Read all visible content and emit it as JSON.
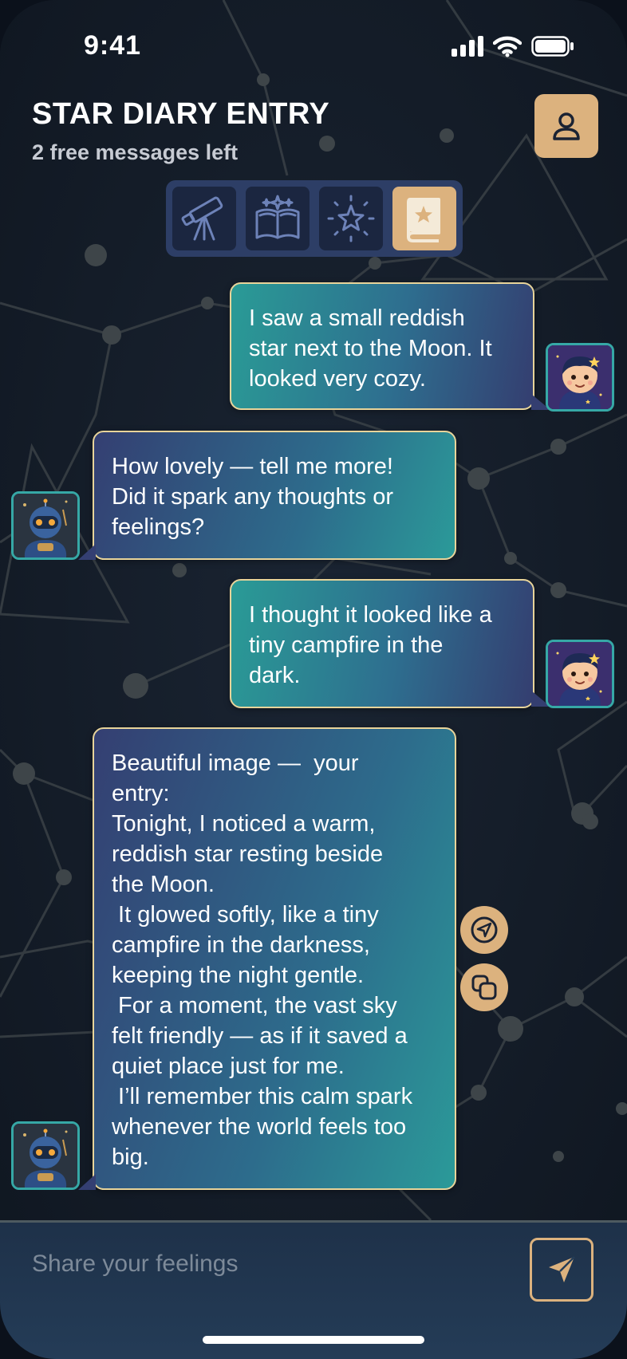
{
  "status": {
    "time": "9:41"
  },
  "header": {
    "title": "STAR DIARY ENTRY",
    "subtitle": "2 free messages left"
  },
  "modes": [
    {
      "icon": "telescope-icon",
      "active": false
    },
    {
      "icon": "open-book-sparkle-icon",
      "active": false
    },
    {
      "icon": "shining-star-icon",
      "active": false
    },
    {
      "icon": "star-diary-book-icon",
      "active": true
    }
  ],
  "messages": [
    {
      "role": "user",
      "lines": [
        "I saw a small reddish",
        "star next to the Moon. It",
        "looked very cozy."
      ]
    },
    {
      "role": "bot",
      "lines": [
        "How lovely — tell me more!",
        "Did it spark any thoughts or",
        "feelings?"
      ]
    },
    {
      "role": "user",
      "lines": [
        "I thought it looked like a",
        "tiny campfire in the",
        "dark."
      ]
    },
    {
      "role": "bot",
      "lines": [
        "Beautiful image —  your",
        "entry:",
        "Tonight, I noticed a warm,",
        "reddish star resting beside",
        "the Moon.",
        " It glowed softly, like a tiny",
        "campfire in the darkness,",
        "keeping the night gentle.",
        " For a moment, the vast sky",
        "felt friendly — as if it saved a",
        "quiet place just for me.",
        " I’ll remember this calm spark",
        "whenever the world feels too",
        "big."
      ]
    }
  ],
  "composer": {
    "placeholder": "Share your feelings"
  },
  "colors": {
    "accent": "#dcb27e",
    "bubble_border": "#e8d49a",
    "avatar_border": "#36a8a6",
    "background": "#121a27"
  }
}
